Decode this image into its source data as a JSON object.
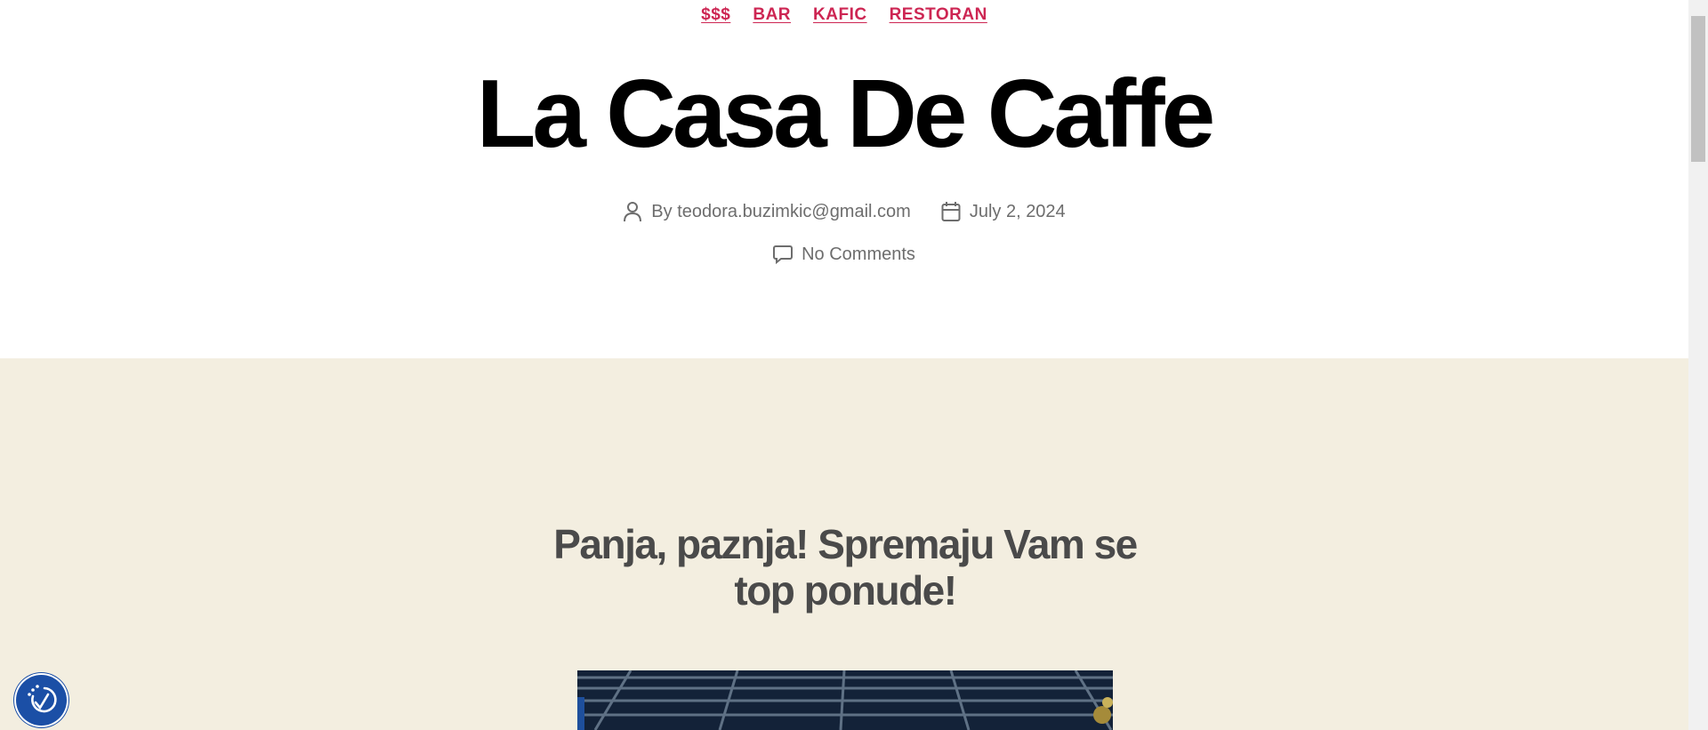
{
  "categories": [
    "$$$",
    "BAR",
    "KAFIC",
    "RESTORAN"
  ],
  "post": {
    "title": "La Casa De Caffe",
    "author_prefix": "By ",
    "author": "teodora.buzimkic@gmail.com",
    "date": "July 2, 2024",
    "comments": "No Comments"
  },
  "content": {
    "heading_line1": "Panja, paznja! Spremaju Vam se",
    "heading_line2": "top ponude!"
  },
  "icons": {
    "author": "person-icon",
    "date": "calendar-icon",
    "comments": "comment-icon",
    "accessibility": "accessibility-icon"
  },
  "colors": {
    "accent": "#cd2653",
    "band": "#f3eee0",
    "heading": "#4a4a4a",
    "a11y": "#1b4fa6"
  }
}
